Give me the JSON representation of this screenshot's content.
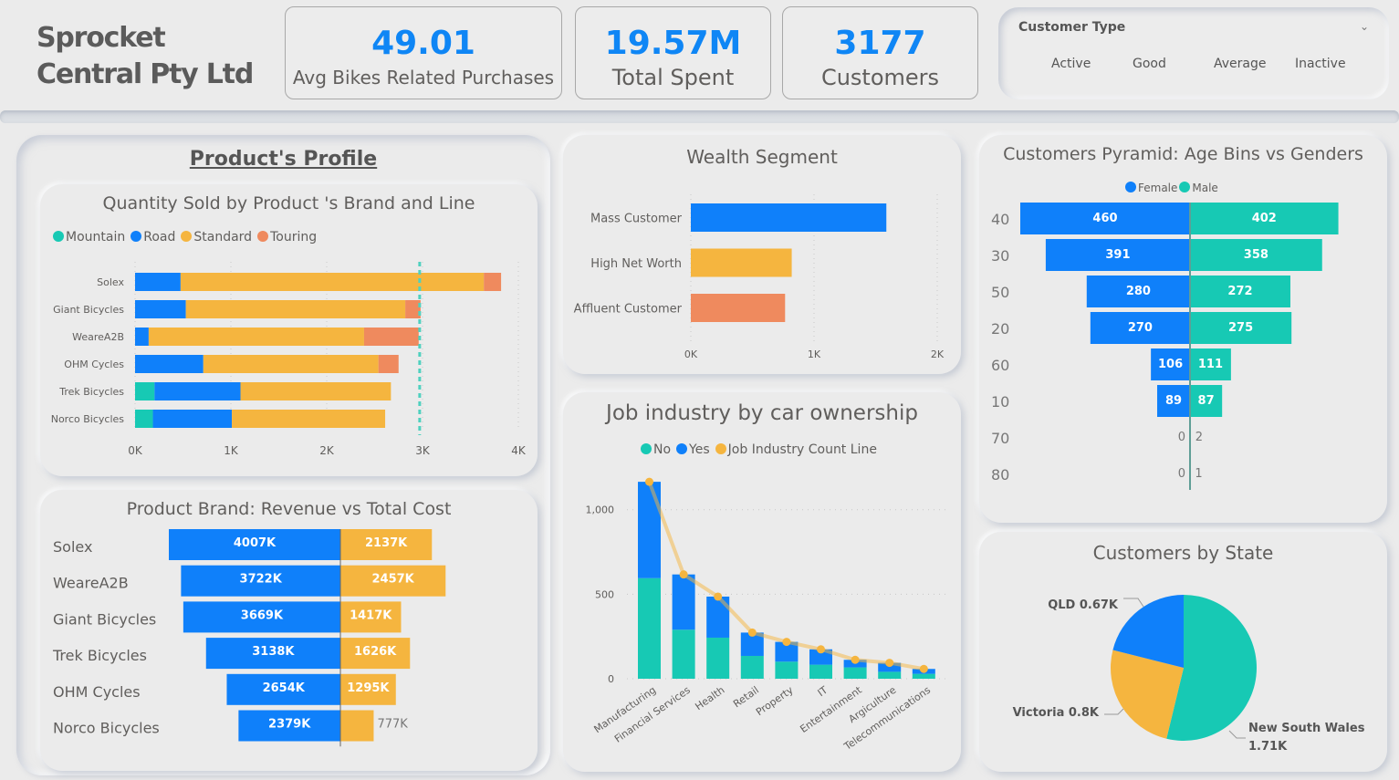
{
  "header": {
    "company": "Sprocket Central Pty Ltd",
    "kpis": [
      {
        "value": "49.01",
        "label": "Avg Bikes Related Purchases"
      },
      {
        "value": "19.57M",
        "label": "Total Spent"
      },
      {
        "value": "3177",
        "label": "Customers"
      }
    ],
    "slicer": {
      "title": "Customer Type",
      "chevron_icon": "chevron-down-icon",
      "options": [
        "Active",
        "Good",
        "Average",
        "Inactive"
      ]
    }
  },
  "products_profile": {
    "title": "Product's Profile"
  },
  "colors": {
    "blue": "#0f80fa",
    "teal": "#17c9b4",
    "yellow": "#f5b53f",
    "orange": "#ef8a5e"
  },
  "chart_data": [
    {
      "id": "quantity_sold",
      "type": "bar",
      "orientation": "horizontal-stacked",
      "title": "Quantity Sold by Product 's Brand and Line",
      "categories": [
        "Solex",
        "Giant Bicycles",
        "WeareA2B",
        "OHM Cycles",
        "Trek Bicycles",
        "Norco Bicycles"
      ],
      "series": [
        {
          "name": "Mountain",
          "color": "#17c9b4",
          "values": [
            0,
            0,
            0,
            0,
            203,
            186
          ]
        },
        {
          "name": "Road",
          "color": "#0f80fa",
          "values": [
            475,
            530,
            142,
            712,
            897,
            824
          ]
        },
        {
          "name": "Standard",
          "color": "#f5b53f",
          "values": [
            3165,
            2290,
            2248,
            1828,
            1570,
            1600
          ]
        },
        {
          "name": "Touring",
          "color": "#ef8a5e",
          "values": [
            180,
            160,
            570,
            210,
            0,
            0
          ]
        }
      ],
      "reference_line": 2970,
      "xticks": [
        "0K",
        "1K",
        "2K",
        "3K",
        "4K"
      ],
      "xlim": [
        0,
        4000
      ],
      "legend": "top-left"
    },
    {
      "id": "revenue_cost",
      "type": "bar",
      "orientation": "horizontal-diverging",
      "title": "Product Brand: Revenue vs Total Cost",
      "categories": [
        "Solex",
        "WeareA2B",
        "Giant Bicycles",
        "Trek Bicycles",
        "OHM Cycles",
        "Norco Bicycles"
      ],
      "series": [
        {
          "name": "Revenue",
          "color": "#0f80fa",
          "values": [
            4007,
            3722,
            3669,
            3138,
            2654,
            2379
          ],
          "labels": [
            "4007K",
            "3722K",
            "3669K",
            "3138K",
            "2654K",
            "2379K"
          ]
        },
        {
          "name": "Total Cost",
          "color": "#f5b53f",
          "values": [
            2137,
            2457,
            1417,
            1626,
            1295,
            777
          ],
          "labels": [
            "2137K",
            "2457K",
            "1417K",
            "1626K",
            "1295K",
            "777K"
          ]
        }
      ],
      "unit": "K"
    },
    {
      "id": "wealth_segment",
      "type": "bar",
      "orientation": "horizontal",
      "title": "Wealth Segment",
      "categories": [
        "Mass Customer",
        "High Net Worth",
        "Affluent Customer"
      ],
      "values": [
        1587,
        819,
        765
      ],
      "colors": [
        "#0f80fa",
        "#f5b53f",
        "#ef8a5e"
      ],
      "xticks": [
        "0K",
        "1K",
        "2K"
      ],
      "xlim": [
        0,
        2000
      ]
    },
    {
      "id": "job_industry",
      "type": "bar",
      "orientation": "vertical-stacked-with-line",
      "title": "Job industry by car ownership",
      "categories": [
        "Manufacturing",
        "Financial Services",
        "Health",
        "Retail",
        "Property",
        "IT",
        "Entertainment",
        "Argiculture",
        "Telecommunications"
      ],
      "series": [
        {
          "name": "No",
          "color": "#17c9b4",
          "values": [
            595,
            290,
            243,
            135,
            101,
            83,
            67,
            41,
            29
          ]
        },
        {
          "name": "Yes",
          "color": "#0f80fa",
          "values": [
            570,
            327,
            243,
            138,
            117,
            91,
            45,
            53,
            29
          ]
        },
        {
          "name": "Job Industry Count Line",
          "color": "#f5b53f",
          "values": [
            1165,
            617,
            486,
            273,
            218,
            174,
            112,
            94,
            58
          ]
        }
      ],
      "yticks": [
        "0",
        "500",
        "1,000"
      ],
      "ylim": [
        0,
        1250
      ],
      "legend": "top-center"
    },
    {
      "id": "age_pyramid",
      "type": "bar",
      "orientation": "horizontal-diverging",
      "title": "Customers Pyramid: Age Bins vs Genders",
      "categories": [
        "40",
        "30",
        "50",
        "20",
        "60",
        "10",
        "70",
        "80"
      ],
      "series": [
        {
          "name": "Female",
          "color": "#0f80fa",
          "values": [
            460,
            391,
            280,
            270,
            106,
            89,
            0,
            0
          ]
        },
        {
          "name": "Male",
          "color": "#17c9b4",
          "values": [
            402,
            358,
            272,
            275,
            111,
            87,
            2,
            1
          ]
        }
      ],
      "legend": "top-center"
    },
    {
      "id": "state",
      "type": "pie",
      "title": "Customers by State",
      "slices": [
        {
          "name": "New South Wales",
          "value": 1710,
          "label": "New South Wales",
          "value_label": "1.71K",
          "color": "#17c9b4"
        },
        {
          "name": "Victoria",
          "value": 800,
          "label": "Victoria 0.8K",
          "color": "#f5b53f"
        },
        {
          "name": "QLD",
          "value": 670,
          "label": "QLD 0.67K",
          "color": "#0f80fa"
        }
      ]
    }
  ]
}
